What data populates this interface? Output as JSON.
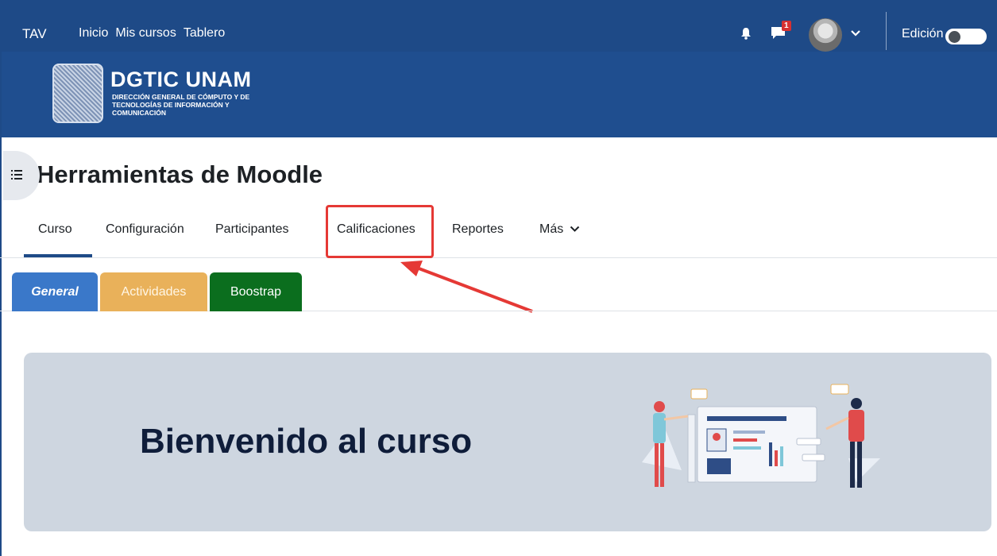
{
  "topnav": {
    "brand": "TAV",
    "links": [
      "Inicio",
      "Mis cursos",
      "Tablero"
    ],
    "notification_count": "1",
    "edit_label": "Edición",
    "icons": [
      "bell-icon",
      "chat-icon",
      "avatar",
      "chevron-down-icon"
    ]
  },
  "banner": {
    "title": "DGTIC UNAM",
    "subtitle": "DIRECCIÓN GENERAL DE CÓMPUTO Y DE TECNOLOGÍAS DE INFORMACIÓN Y COMUNICACIÓN"
  },
  "page": {
    "title": "Herramientas de Moodle"
  },
  "secondary_nav": {
    "items": [
      "Curso",
      "Configuración",
      "Participantes",
      "Calificaciones",
      "Reportes",
      "Más"
    ],
    "active": "Curso"
  },
  "course_tabs": {
    "general": "General",
    "actividades": "Actividades",
    "boostrap": "Boostrap"
  },
  "welcome": {
    "heading": "Bienvenido al curso"
  },
  "colors": {
    "navbar": "#1e4a87",
    "tab_general": "#3a78c9",
    "tab_actividades": "#e9b15a",
    "tab_boostrap": "#0b6e1e",
    "annotation": "#e53935",
    "card_bg": "#ced6e0"
  }
}
